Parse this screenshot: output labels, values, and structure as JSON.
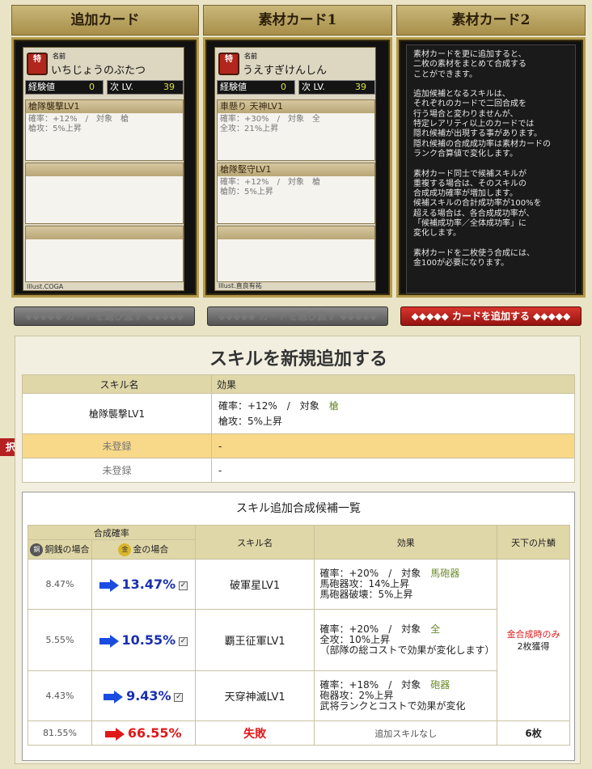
{
  "columns": {
    "add_card": "追加カード",
    "material1": "素材カード1",
    "material2": "素材カード2"
  },
  "card1": {
    "name_label": "名前",
    "name": "いちじょうのぶたつ",
    "icon": "特",
    "exp_label": "経験値",
    "exp_value": "0",
    "next_label": "次 LV.",
    "next_value": "39",
    "skills": [
      {
        "name": "槍隊襲撃LV1",
        "line1": "確率：+12%　/　対象　槍",
        "line2": "槍攻：5%上昇"
      },
      {
        "name": "",
        "line1": "",
        "line2": ""
      },
      {
        "name": "",
        "line1": "",
        "line2": ""
      }
    ],
    "illust": "Illust.COGA"
  },
  "card2": {
    "name_label": "名前",
    "name": "うえすぎけんしん",
    "icon": "特",
    "exp_label": "経験値",
    "exp_value": "0",
    "next_label": "次 LV.",
    "next_value": "39",
    "skills": [
      {
        "name": "車懸り 天神LV1",
        "line1": "確率：+30%　/　対象　全",
        "line2": "全攻：21%上昇"
      },
      {
        "name": "槍隊堅守LV1",
        "line1": "確率：+12%　/　対象　槍",
        "line2": "槍防：5%上昇"
      },
      {
        "name": "",
        "line1": "",
        "line2": ""
      }
    ],
    "illust": "Illust.直良有祐"
  },
  "info_text": "素材カードを更に追加すると、\n二枚の素材をまとめて合成する\nことができます。\n\n追加候補となるスキルは、\nそれぞれのカードで二回合成を\n行う場合と変わりませんが、\n特定レアリティ以上のカードでは\n隠れ候補が出現する事があります。\n隠れ候補の合成成功率は素材カードの\nランク合算値で変化します。\n\n素材カード同士で候補スキルが\n重複する場合は、そのスキルの\n合成成功確率が増加します。\n候補スキルの合計成功率が100%を\n超える場合は、各合成成功率が、\n「候補成功率／全体成功率」に\n変化します。\n\n素材カードを二枚使う合成には、\n金100が必要になります。",
  "buttons": {
    "reselect1": "カードを選び直す",
    "reselect2": "カードを選び直す",
    "add_card": "カードを追加する"
  },
  "section": {
    "title": "スキルを新規追加する",
    "col_skill": "スキル名",
    "col_effect": "効果",
    "rows": [
      {
        "skill": "槍隊襲撃LV1",
        "eff1": "確率：+12%　/　対象",
        "eff1t": "槍",
        "eff2": "槍攻：5%上昇"
      },
      {
        "skill": "未登録",
        "eff1": "-"
      },
      {
        "skill": "未登録",
        "eff1": "-"
      }
    ],
    "tab_label": "択中"
  },
  "candidates": {
    "title": "スキル追加合成候補一覧",
    "h_rate": "合成確率",
    "h_copper": "銅銭の場合",
    "h_gold": "金の場合",
    "h_skill": "スキル名",
    "h_effect": "効果",
    "h_scale": "天下の片鱗",
    "copper_coin": "銅",
    "gold_coin": "金",
    "rows": [
      {
        "copper": "8.47%",
        "gold": "13.47%",
        "skill": "破軍星LV1",
        "e1": "確率：+20%　/　対象",
        "e1t": "馬砲器",
        "e2": "馬砲器攻：14%上昇",
        "e3": "馬砲器破壊：5%上昇"
      },
      {
        "copper": "5.55%",
        "gold": "10.55%",
        "skill": "覇王征軍LV1",
        "e1": "確率：+20%　/　対象",
        "e1t": "全",
        "e2": "全攻：10%上昇",
        "e3": "（部隊の総コストで効果が変化します）"
      },
      {
        "copper": "4.43%",
        "gold": "9.43%",
        "skill": "天穿神滅LV1",
        "e1": "確率：+18%　/　対象",
        "e1t": "砲器",
        "e2": "砲器攻：2%上昇",
        "e3": "武将ランクとコストで効果が変化"
      }
    ],
    "scale_note1": "金合成時のみ",
    "scale_note2": "2枚獲得",
    "fail": {
      "copper": "81.55%",
      "gold": "66.55%",
      "skill": "失敗",
      "effect": "追加スキルなし",
      "scale": "6枚"
    },
    "check": "✓"
  },
  "colors": {
    "accent_red": "#d8352e",
    "rate_blue": "#1a2fb0",
    "fail_red": "#e01818"
  }
}
